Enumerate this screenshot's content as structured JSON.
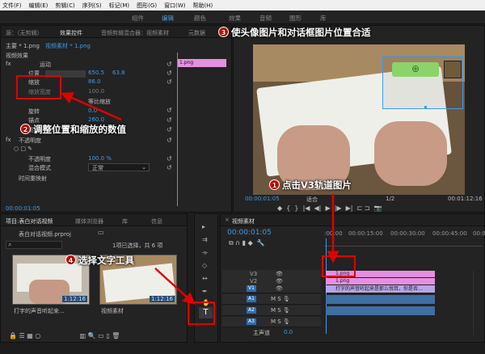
{
  "menu": [
    "文件(F)",
    "编辑(E)",
    "剪辑(C)",
    "序列(S)",
    "标记(M)",
    "图形(G)",
    "窗口(W)",
    "帮助(H)"
  ],
  "workspaces": [
    "组件",
    "编辑",
    "颜色",
    "效果",
    "音频",
    "图形",
    "库"
  ],
  "source_panel": {
    "tabs": [
      "源：（无剪辑）",
      "效果控件",
      "音频剪辑混合器：视频素材",
      "元数据"
    ],
    "clip_header": "主要 * 1.png",
    "clip_target": "视频素材 * 1.png",
    "section_video": "视频效果",
    "motion": "运动",
    "position_label": "位置",
    "position_x": "650.5",
    "position_y": "63.8",
    "scale_label": "缩放",
    "scale_value": "86.0",
    "scale_width_label": "缩放宽度",
    "scale_width_value": "100.0",
    "uniform_scale": "等比缩放",
    "rotation_label": "旋转",
    "rotation_value": "0.0",
    "anchor_label": "锚点",
    "anchor_value": "260.0",
    "flicker_label": "防闪烁滤镜",
    "flicker_value": "0.00",
    "opacity_group": "不透明度",
    "opacity_label": "不透明度",
    "opacity_value": "100.0 %",
    "blend_label": "混合模式",
    "blend_value": "正常",
    "time_remap": "时间重映射",
    "timecode": "00:00:01:05",
    "mini_clip": "1.png"
  },
  "program_monitor": {
    "timecode_left": "00:00:01:05",
    "fit_label": "适合",
    "quality": "1/2",
    "timecode_right": "00:01:12:16"
  },
  "project_panel": {
    "tabs": [
      "项目:表白对话视频",
      "媒体浏览器",
      "库",
      "信息"
    ],
    "file": "表白对话视频.prproj",
    "selection_info": "1项已选择，共 6 项",
    "thumb1_label": "打字的声音听起来...",
    "thumb1_duration": "1:12:16",
    "thumb2_label": "视频素材",
    "thumb2_duration": "1:12:16"
  },
  "timeline": {
    "tab": "视频素材",
    "timecode": "00:00:01:05",
    "ruler": [
      ":00:00",
      "00:00:15:00",
      "00:00:30:00",
      "00:00:45:00",
      "00:0"
    ],
    "tracks": [
      "V3",
      "V2",
      "V1",
      "A1",
      "A2",
      "A3"
    ],
    "master_label": "主声道",
    "master_value": "0.0",
    "clip_v3": "1.png",
    "clip_v2": "1.png",
    "clip_v1": "打字的声音听起来是那么悦耳，你是否..."
  },
  "callouts": [
    {
      "n": "1",
      "text": "点击V3轨道图片"
    },
    {
      "n": "2",
      "text": "调整位置和缩放的数值"
    },
    {
      "n": "3",
      "text": "使头像图片和对话框图片位置合适"
    },
    {
      "n": "4",
      "text": "选择文字工具"
    }
  ],
  "colors": {
    "accent": "#3e9be8",
    "highlight": "#e10000",
    "clip_pink": "#e58fe0",
    "clip_v1": "#b7a6e8",
    "audio_blue": "#3f6fa3"
  }
}
